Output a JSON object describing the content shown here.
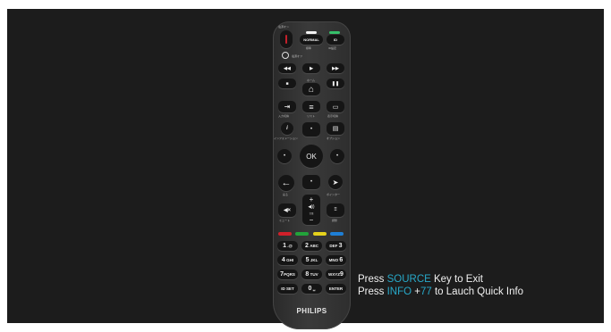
{
  "remote": {
    "brand": "PHILIPS",
    "power_label": "電源オン",
    "normal_label": "NORMAL",
    "normal_sub": "標準",
    "id_label": "ID",
    "id_sub": "ID設定",
    "power_off_label": "電源オフ",
    "home_label": "ホーム",
    "input_label": "入力切換",
    "list_label": "リスト",
    "display_label": "表示切換",
    "info_label": "インフォメーション",
    "options_label": "オプション",
    "ok_label": "OK",
    "back_label": "戻る",
    "pointer_label": "ポインター",
    "mute_label": "ミュート",
    "volume_label": "音量",
    "adjust_label": "調整",
    "keys": [
      {
        "big": "1",
        "small": ".@"
      },
      {
        "big": "2",
        "small": "ABC"
      },
      {
        "big": "3",
        "small": "DEF"
      },
      {
        "big": "4",
        "small": "GHI"
      },
      {
        "big": "5",
        "small": "JKL"
      },
      {
        "big": "6",
        "small": "MNO"
      },
      {
        "big": "7",
        "small": "PQRS"
      },
      {
        "big": "8",
        "small": "TUV"
      },
      {
        "big": "9",
        "small": "WXYZ"
      },
      {
        "big": "",
        "small": "ID SET"
      },
      {
        "big": "0",
        "small": "␣"
      },
      {
        "big": "",
        "small": "ENTER"
      }
    ],
    "colors": {
      "red": "#d0202a",
      "green": "#22a33a",
      "yellow": "#e6d21c",
      "blue": "#1e7fd6",
      "accent": "#27a9c9",
      "power": "#c2202a"
    }
  },
  "instructions": {
    "line1_pre": "Press ",
    "line1_key": "SOURCE",
    "line1_post": " Key to Exit",
    "line2_pre": "Press ",
    "line2_key": "INFO",
    "line2_plus": " +",
    "line2_code": "77",
    "line2_post": " to Lauch Quick Info"
  }
}
